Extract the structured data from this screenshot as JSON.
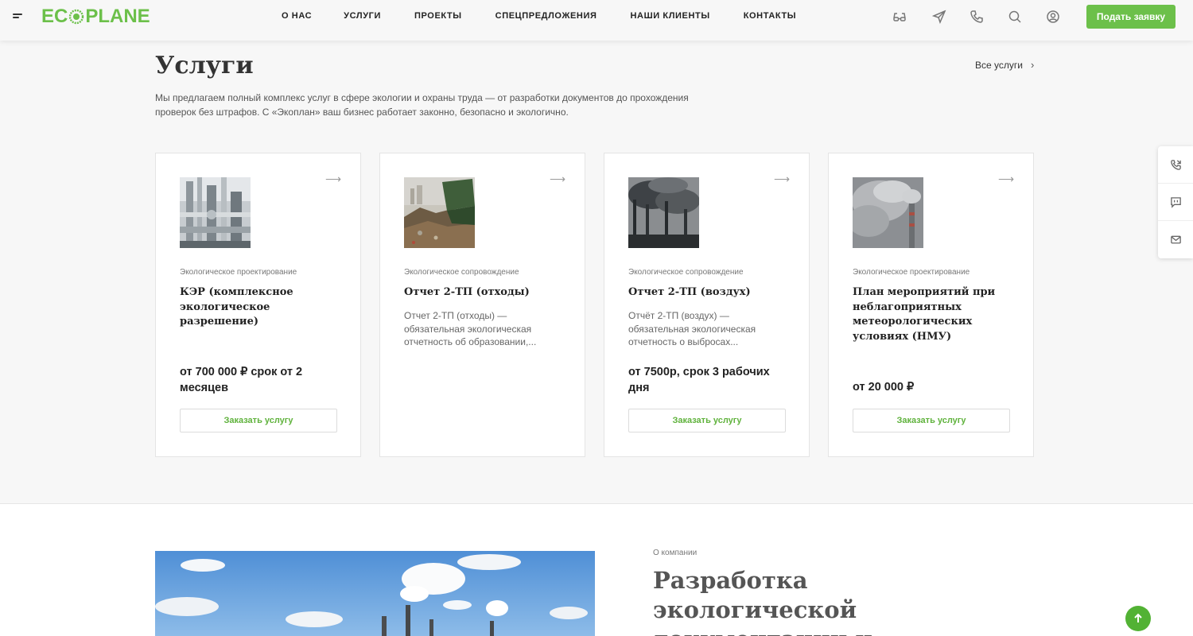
{
  "header": {
    "logo_left": "EC",
    "logo_right": "PLANE",
    "nav": [
      "О НАС",
      "УСЛУГИ",
      "ПРОЕКТЫ",
      "СПЕЦПРЕДЛОЖЕНИЯ",
      "НАШИ КЛИЕНТЫ",
      "КОНТАКТЫ"
    ],
    "icons": [
      "glasses-icon",
      "send-icon",
      "phone-icon",
      "search-icon",
      "user-icon"
    ],
    "apply_label": "Подать заявку"
  },
  "services": {
    "title": "Услуги",
    "all_link": "Все услуги",
    "description": "Мы предлагаем полный комплекс услуг в сфере экологии и охраны труда — от разработки документов до прохождения проверок без штрафов. С «Экоплан» ваш бизнес работает законно, безопасно и экологично.",
    "cards": [
      {
        "category": "Экологическое проектирование",
        "title": "КЭР (комплексное экологическое разрешение)",
        "description": "",
        "price": "от 700 000 ₽ срок от 2 месяцев",
        "button": "Заказать услугу",
        "image": "pipes"
      },
      {
        "category": "Экологическое сопровождение",
        "title": "Отчет 2-ТП (отходы)",
        "description": "Отчет 2-ТП (отходы) — обязательная экологическая отчетность об образовании,...",
        "price": "",
        "button": "",
        "image": "garbage"
      },
      {
        "category": "Экологическое сопровождение",
        "title": "Отчет 2-ТП (воздух)",
        "description": "Отчёт 2-ТП (воздух) — обязательная экологическая отчетность о выбросах...",
        "price": "от 7500р, срок 3 рабочих дня",
        "button": "Заказать услугу",
        "image": "chimneys"
      },
      {
        "category": "Экологическое проектирование",
        "title": "План мероприятий при неблагоприятных метеорологических условиях (НМУ)",
        "description": "",
        "price": "от 20 000 ₽",
        "button": "Заказать услугу",
        "image": "smoke"
      }
    ]
  },
  "about": {
    "kicker": "О компании",
    "title": "Разработка экологической документации и"
  },
  "colors": {
    "accent": "#6cc04a",
    "text": "#333333",
    "background": "#f7f7f7"
  }
}
